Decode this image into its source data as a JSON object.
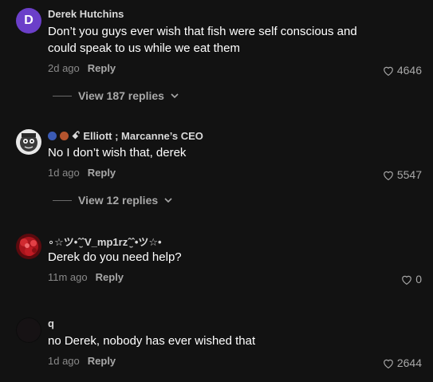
{
  "comments": [
    {
      "avatar_letter": "D",
      "avatar_color": "#6b3fc9",
      "username": "Derek Hutchins",
      "text": "Don’t you guys ever wish that fish were self conscious and could speak to us while we eat them",
      "time": "2d ago",
      "reply_label": "Reply",
      "likes": "4646",
      "view_replies": "View 187 replies"
    },
    {
      "avatar_icon": "cartoon-face-avatar",
      "badges": [
        "#3b5bb5",
        "#b5542e"
      ],
      "username_prefix": "ꗃ",
      "username": "Elliott ; Marcanne’s CEO",
      "text": "No I don’t wish that, derek",
      "time": "1d ago",
      "reply_label": "Reply",
      "likes": "5547",
      "view_replies": "View 12 replies"
    },
    {
      "avatar_icon": "red-pattern-avatar",
      "username": "∘☆ツ•ˆ̮ˆV_mp1rzˆ̮ˆ•ツ☆•",
      "text": "Derek do you need help?",
      "time": "11m ago",
      "reply_label": "Reply",
      "likes": "0"
    },
    {
      "avatar_icon": "dark-avatar",
      "username": "q",
      "text": "no Derek, nobody has ever wished that",
      "time": "1d ago",
      "reply_label": "Reply",
      "likes": "2644"
    }
  ]
}
